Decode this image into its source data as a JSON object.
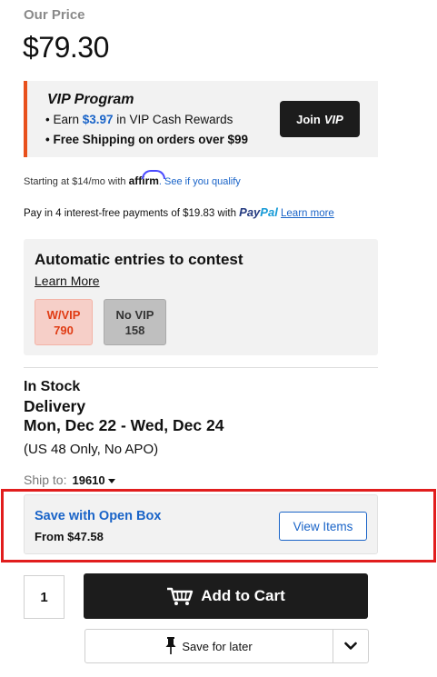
{
  "price_section": {
    "label": "Our Price",
    "price": "$79.30"
  },
  "vip": {
    "title": "VIP Program",
    "earn_prefix": "• Earn ",
    "earn_amount": "$3.97",
    "earn_suffix": " in VIP Cash Rewards",
    "shipping": "• Free Shipping on orders over $99",
    "join_label": "Join",
    "join_vip": "VIP",
    "accent_color": "#e8501c"
  },
  "affirm": {
    "prefix": "Starting at $14/mo with ",
    "logo": "affirm",
    "link": ". See if you qualify"
  },
  "paypal": {
    "prefix": "Pay in 4 interest-free payments of $19.83 with ",
    "logo_pay": "Pay",
    "logo_pal": "Pal",
    "learn_more": "Learn more"
  },
  "contest": {
    "title": "Automatic entries to contest",
    "learn_more": "Learn More",
    "vip_label": "W/VIP",
    "vip_count": "790",
    "novip_label": "No VIP",
    "novip_count": "158"
  },
  "stock": {
    "status": "In Stock",
    "delivery_label": "Delivery",
    "delivery_dates": "Mon, Dec 22 - Wed, Dec 24",
    "delivery_note": "(US 48 Only, No APO)",
    "ship_to_label": "Ship to:",
    "zip": "19610"
  },
  "open_box": {
    "title": "Save with Open Box",
    "from": "From $47.58",
    "button": "View Items"
  },
  "cart": {
    "quantity": "1",
    "add_label": "Add to Cart",
    "save_label": "Save for later"
  },
  "icons": [
    "cart-icon",
    "pin-icon",
    "chevron-down-icon",
    "caret-down-icon"
  ]
}
